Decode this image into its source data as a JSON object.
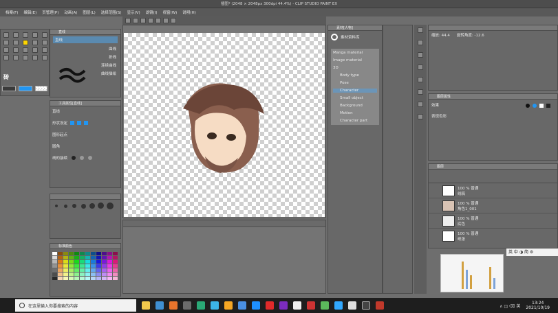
{
  "window": {
    "title": "插图* (2048 × 2048px 300dpi 44.4%) - CLIP STUDIO PAINT EX"
  },
  "menu": [
    "档案(F)",
    "编辑(E)",
    "页管理(P)",
    "动画(A)",
    "图层(L)",
    "选择范围(S)",
    "显示(V)",
    "滤镜(I)",
    "视窗(W)",
    "说明(H)"
  ],
  "subtool": {
    "title": "直线",
    "items": [
      "直线",
      "曲线",
      "折线",
      "连续曲线",
      "曲线描绘"
    ],
    "brush_label": "砖"
  },
  "tool_property": {
    "title": "工具属性[直线]",
    "rows": [
      "直线",
      "形状设定",
      "图形起点",
      "圆角",
      "线的接续"
    ]
  },
  "material": {
    "title": "素材[人物]",
    "search_label": "素材资料库",
    "items": [
      "Manga material",
      "Image material",
      "3D",
      "Body type",
      "Pose",
      "Character",
      "Small object",
      "Background",
      "Motion",
      "Character part"
    ]
  },
  "color_set": {
    "title": "标准颜色"
  },
  "layer_props": {
    "title": "图层属性",
    "blend_label": "效果",
    "expression_label": "表现色彩"
  },
  "navigator": {
    "zoom_label": "缩放: 44.4",
    "rotate_label": "旋转角度: -12.6"
  },
  "layers": {
    "title": "图层",
    "items": [
      {
        "name": "线稿",
        "mode": "100 % 普通"
      },
      {
        "name": "角色1_001",
        "mode": "100 % 普通"
      },
      {
        "name": "底色",
        "mode": "100 % 普通"
      },
      {
        "name": "纸张",
        "mode": "100 % 普通"
      }
    ]
  },
  "ime": {
    "text": "英 中 ◑ 简 ⚙"
  },
  "taskbar": {
    "search_placeholder": "在这里输入你要搜索的内容",
    "time": "13:24",
    "date": "2021/10/19",
    "tray": "∧ ◫ ⌫ 英"
  },
  "colors": {
    "app_bg": "#6e6e6e",
    "accent_blue": "#2196f3",
    "taskbar_bg": "#1e1e1e"
  }
}
